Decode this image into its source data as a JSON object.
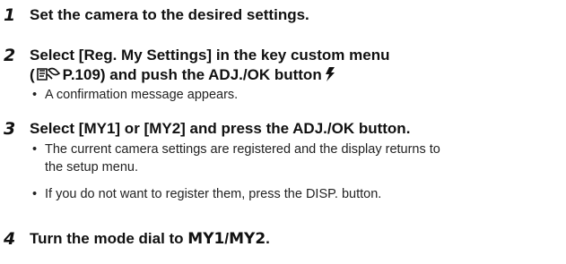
{
  "steps": [
    {
      "number": "1",
      "text": "Set the camera to the desired settings."
    },
    {
      "number": "2",
      "line1": "Select [Reg. My Settings] in the key custom menu",
      "line2_prefix": "(",
      "page_ref": "P.109",
      "line2_suffix": ") and push the ADJ./OK button",
      "bullets": [
        "A confirmation message appears."
      ]
    },
    {
      "number": "3",
      "text": "Select [MY1] or [MY2] and press the ADJ./OK button.",
      "bullets": [
        {
          "line1": "The current camera settings are registered and the display returns to",
          "line2": "the setup menu."
        },
        "If you do not want to register them, press the DISP. button."
      ]
    },
    {
      "number": "4",
      "text_prefix": "Turn the mode dial to ",
      "mode1": "MY1",
      "separator": "/",
      "mode2": "MY2",
      "text_suffix": "."
    }
  ],
  "bullet_glyph": "•",
  "icons": {
    "reference": "reference-book-icon",
    "flash": "flash-icon"
  }
}
